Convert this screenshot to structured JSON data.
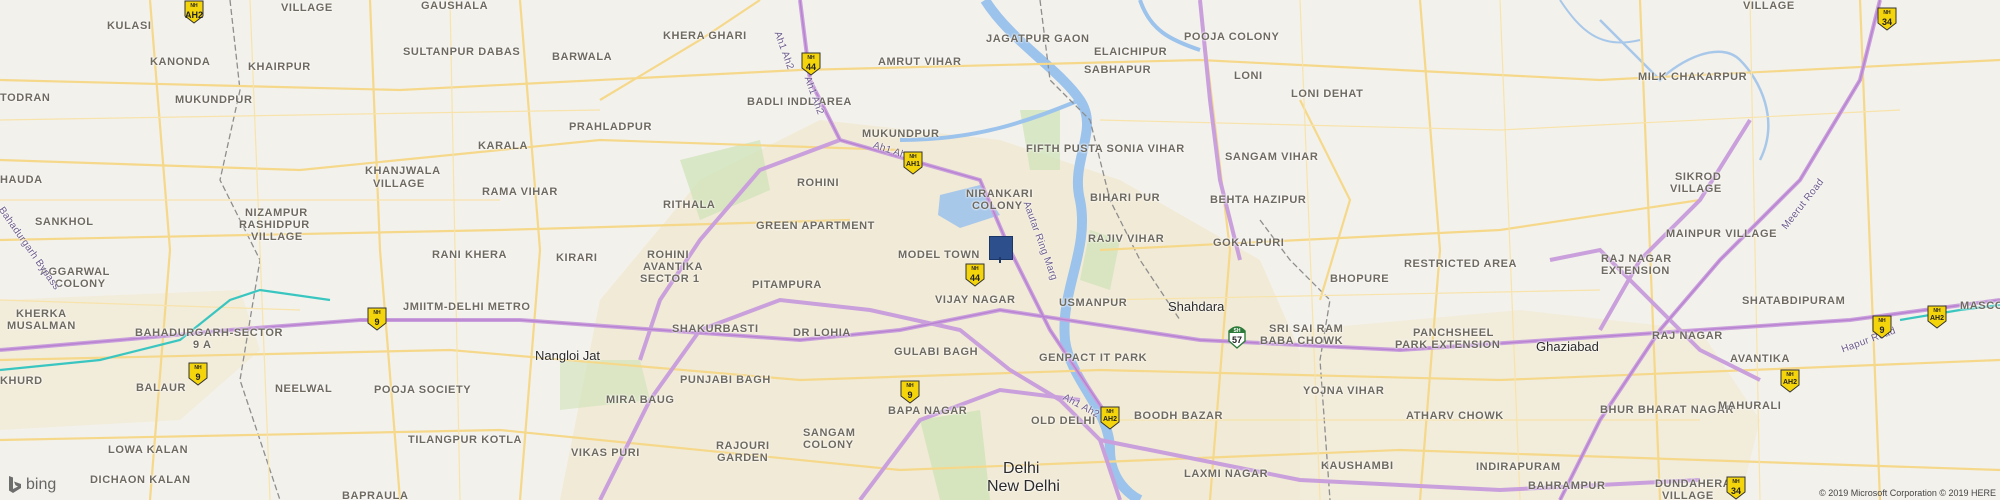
{
  "map": {
    "places": [
      {
        "id": "kulasi",
        "text": "KULASI"
      },
      {
        "id": "gaushala",
        "text": "GAUSHALA"
      },
      {
        "id": "khera-ghari",
        "text": "KHERA GHARI"
      },
      {
        "id": "jagatpur-gaon",
        "text": "JAGATPUR GAON"
      },
      {
        "id": "elaichipur",
        "text": "ELAICHIPUR"
      },
      {
        "id": "pooja-colony",
        "text": "POOJA COLONY"
      },
      {
        "id": "kanonda",
        "text": "KANONDA"
      },
      {
        "id": "sultanpur-dabas",
        "text": "SULTANPUR DABAS"
      },
      {
        "id": "barwala",
        "text": "BARWALA"
      },
      {
        "id": "amrut-vihar",
        "text": "AMRUT VIHAR"
      },
      {
        "id": "khairpur",
        "text": "KHAIRPUR"
      },
      {
        "id": "sabhapur",
        "text": "SABHAPUR"
      },
      {
        "id": "loni",
        "text": "LONI"
      },
      {
        "id": "loni-dehat",
        "text": "LONI DEHAT"
      },
      {
        "id": "milk-chakarpur",
        "text": "MILK CHAKARPUR"
      },
      {
        "id": "todran",
        "text": "TODRAN"
      },
      {
        "id": "badli-indl-area",
        "text": "BADLI INDL AREA"
      },
      {
        "id": "mukundpur-w",
        "text": "MUKUNDPUR"
      },
      {
        "id": "prahladpur",
        "text": "PRAHLADPUR"
      },
      {
        "id": "mukundpur",
        "text": "MUKUNDPUR"
      },
      {
        "id": "karala",
        "text": "KARALA"
      },
      {
        "id": "fifth-pusta",
        "text": "FIFTH PUSTA SONIA VIHAR"
      },
      {
        "id": "sangam-vihar",
        "text": "SANGAM VIHAR"
      },
      {
        "id": "sikrod",
        "text": "SIKROD"
      },
      {
        "id": "sikrod2",
        "text": "VILLAGE"
      },
      {
        "id": "hauda",
        "text": "HAUDA"
      },
      {
        "id": "khanjwala",
        "text": "KHANJWALA"
      },
      {
        "id": "khanjwala2",
        "text": "VILLAGE"
      },
      {
        "id": "rohini",
        "text": "ROHINI"
      },
      {
        "id": "nirankari",
        "text": "NIRANKARI"
      },
      {
        "id": "nirankari2",
        "text": "COLONY"
      },
      {
        "id": "rama-vihar",
        "text": "RAMA VIHAR"
      },
      {
        "id": "bihari-pur",
        "text": "BIHARI PUR"
      },
      {
        "id": "behta-hazipur",
        "text": "BEHTA HAZIPUR"
      },
      {
        "id": "rithala",
        "text": "RITHALA"
      },
      {
        "id": "nizampur",
        "text": "NIZAMPUR"
      },
      {
        "id": "nizampur2",
        "text": "RASHIDPUR"
      },
      {
        "id": "nizampur3",
        "text": "VILLAGE"
      },
      {
        "id": "sankhol",
        "text": "SANKHOL"
      },
      {
        "id": "green-apartment",
        "text": "GREEN APARTMENT"
      },
      {
        "id": "rajiv-vihar",
        "text": "RAJIV VIHAR"
      },
      {
        "id": "gokalpuri",
        "text": "GOKALPURI"
      },
      {
        "id": "mainpur",
        "text": "MAINPUR VILLAGE"
      },
      {
        "id": "rohini-avantika",
        "text": "ROHINI"
      },
      {
        "id": "rohini-avantika2",
        "text": "AVANTIKA"
      },
      {
        "id": "rohini-avantika3",
        "text": "SECTOR 1"
      },
      {
        "id": "aggarwal",
        "text": "AGGARWAL"
      },
      {
        "id": "aggarwal2",
        "text": "COLONY"
      },
      {
        "id": "rani-khera",
        "text": "RANI KHERA"
      },
      {
        "id": "kirari",
        "text": "KIRARI"
      },
      {
        "id": "model-town",
        "text": "MODEL TOWN"
      },
      {
        "id": "restricted-area",
        "text": "RESTRICTED AREA"
      },
      {
        "id": "bhopure",
        "text": "BHOPURE"
      },
      {
        "id": "raj-nagar-ext",
        "text": "RAJ NAGAR"
      },
      {
        "id": "raj-nagar-ext2",
        "text": "EXTENSION"
      },
      {
        "id": "pitampura",
        "text": "PITAMPURA"
      },
      {
        "id": "usmanpur",
        "text": "USMANPUR"
      },
      {
        "id": "vijay-nagar",
        "text": "VIJAY NAGAR"
      },
      {
        "id": "jmiitm",
        "text": "JMIITM-DELHI METRO"
      },
      {
        "id": "shatabdipuram",
        "text": "SHATABDIPURAM"
      },
      {
        "id": "kherka",
        "text": "KHERKA"
      },
      {
        "id": "kherka2",
        "text": "MUSALMAN"
      },
      {
        "id": "shakurbasti",
        "text": "SHAKURBASTI"
      },
      {
        "id": "sri-sai-ram",
        "text": "SRI SAI RAM"
      },
      {
        "id": "sri-sai-ram2",
        "text": "BABA CHOWK"
      },
      {
        "id": "raj-nagar",
        "text": "RAJ NAGAR"
      },
      {
        "id": "bahadurgarh-sector",
        "text": "BAHADURGARH-SECTOR"
      },
      {
        "id": "bahadurgarh-sector2",
        "text": "9 A"
      },
      {
        "id": "dr-lohia",
        "text": "DR LOHIA"
      },
      {
        "id": "gulabi-bagh",
        "text": "GULABI BAGH"
      },
      {
        "id": "panchsheel",
        "text": "PANCHSHEEL"
      },
      {
        "id": "panchsheel2",
        "text": "PARK EXTENSION"
      },
      {
        "id": "khurd",
        "text": "KHURD"
      },
      {
        "id": "avantika",
        "text": "AVANTIKA"
      },
      {
        "id": "balaur",
        "text": "BALAUR"
      },
      {
        "id": "genpact",
        "text": "GENPACT IT PARK"
      },
      {
        "id": "punjabi-bagh",
        "text": "PUNJABI BAGH"
      },
      {
        "id": "neelwal",
        "text": "NEELWAL"
      },
      {
        "id": "pooja-society",
        "text": "POOJA SOCIETY"
      },
      {
        "id": "mira-baug",
        "text": "MIRA BAUG"
      },
      {
        "id": "yojna-vihar",
        "text": "YOJNA VIHAR"
      },
      {
        "id": "bhur-bharat",
        "text": "BHUR BHARAT NAGAR"
      },
      {
        "id": "mahurali",
        "text": "MAHURALI"
      },
      {
        "id": "bapa-nagar",
        "text": "BAPA NAGAR"
      },
      {
        "id": "boodh-bazar",
        "text": "BOODH BAZAR"
      },
      {
        "id": "old-delhi",
        "text": "OLD DELHI"
      },
      {
        "id": "atharv-chowk",
        "text": "ATHARV CHOWK"
      },
      {
        "id": "tilangpur",
        "text": "TILANGPUR KOTLA"
      },
      {
        "id": "sangam-colony",
        "text": "SANGAM"
      },
      {
        "id": "sangam-colony2",
        "text": "COLONY"
      },
      {
        "id": "lowa-kalan",
        "text": "LOWA KALAN"
      },
      {
        "id": "vikas-puri",
        "text": "VIKAS PURI"
      },
      {
        "id": "rajouri",
        "text": "RAJOURI"
      },
      {
        "id": "rajouri2",
        "text": "GARDEN"
      },
      {
        "id": "kaushambi",
        "text": "KAUSHAMBI"
      },
      {
        "id": "indirapuram",
        "text": "INDIRAPURAM"
      },
      {
        "id": "dichaon-kalan",
        "text": "DICHAON KALAN"
      },
      {
        "id": "laxmi-nagar",
        "text": "LAXMI NAGAR"
      },
      {
        "id": "bahrampur",
        "text": "BAHRAMPUR"
      },
      {
        "id": "dundahera",
        "text": "DUNDAHERA"
      },
      {
        "id": "dundahera2",
        "text": "VILLAGE"
      },
      {
        "id": "bapraula",
        "text": "BAPRAULA"
      },
      {
        "id": "masco",
        "text": "MASCO"
      },
      {
        "id": "village-top",
        "text": "VILLAGE"
      },
      {
        "id": "village-tr",
        "text": "VILLAGE"
      }
    ],
    "cities": [
      {
        "id": "shahdara",
        "text": "Shahdara"
      },
      {
        "id": "nangloi",
        "text": "Nangloi Jat"
      },
      {
        "id": "ghaziabad",
        "text": "Ghaziabad"
      }
    ],
    "capital": {
      "delhi": "Delhi",
      "new_delhi": "New Delhi"
    },
    "roads": [
      {
        "id": "ah1-ah2-a",
        "text": "Ah1 Ah2"
      },
      {
        "id": "ah1-ah2-b",
        "text": "Ah1 Ah2"
      },
      {
        "id": "ah1-ah2-c",
        "text": "Ah1 Ah2"
      },
      {
        "id": "ah1-ah2-d",
        "text": "Ah1 Ah2"
      },
      {
        "id": "aurobindo",
        "text": "Aautar Ring Marg"
      },
      {
        "id": "bahadurgarh-bypass",
        "text": "Bahadurgarh Bypass"
      },
      {
        "id": "meerut-road",
        "text": "Meerut Road"
      },
      {
        "id": "hapur-road",
        "text": "Hapur Road"
      }
    ],
    "shields": [
      {
        "id": "nh44-a",
        "top": "NH",
        "num": "44",
        "kind": "yellow"
      },
      {
        "id": "ah1",
        "top": "NH",
        "num": "AH1",
        "kind": "yellow"
      },
      {
        "id": "nh44-b",
        "top": "NH",
        "num": "44",
        "kind": "yellow"
      },
      {
        "id": "nh9-a",
        "top": "NH",
        "num": "9",
        "kind": "yellow"
      },
      {
        "id": "nh9-b",
        "top": "NH",
        "num": "9",
        "kind": "yellow"
      },
      {
        "id": "nh9-c",
        "top": "NH",
        "num": "9",
        "kind": "yellow"
      },
      {
        "id": "ah2-a",
        "top": "NH",
        "num": "AH2",
        "kind": "yellow"
      },
      {
        "id": "sh57",
        "top": "SH",
        "num": "57",
        "kind": "green"
      },
      {
        "id": "nh34-a",
        "top": "NH",
        "num": "34",
        "kind": "yellow"
      },
      {
        "id": "nh9-d",
        "top": "NH",
        "num": "9",
        "kind": "yellow"
      },
      {
        "id": "ah2-b",
        "top": "NH",
        "num": "AH2",
        "kind": "yellow"
      },
      {
        "id": "ah2-c",
        "top": "NH",
        "num": "AH2",
        "kind": "yellow"
      },
      {
        "id": "nh34-b",
        "top": "NH",
        "num": "34",
        "kind": "yellow"
      }
    ],
    "logo": "bing",
    "copyright": "© 2019 Microsoft Corporation © 2019 HERE",
    "colors": {
      "land": "#f3f1ec",
      "urban": "#f1ead6",
      "park": "#cfe3b8",
      "water": "#a8c8ea",
      "river": "#9cc3ec",
      "highway": "#c9a0dc",
      "highway_core": "#b982d1",
      "arterial": "#f5d88a",
      "metro": "#3ac6c0",
      "marker": "#2d4f8c"
    }
  }
}
